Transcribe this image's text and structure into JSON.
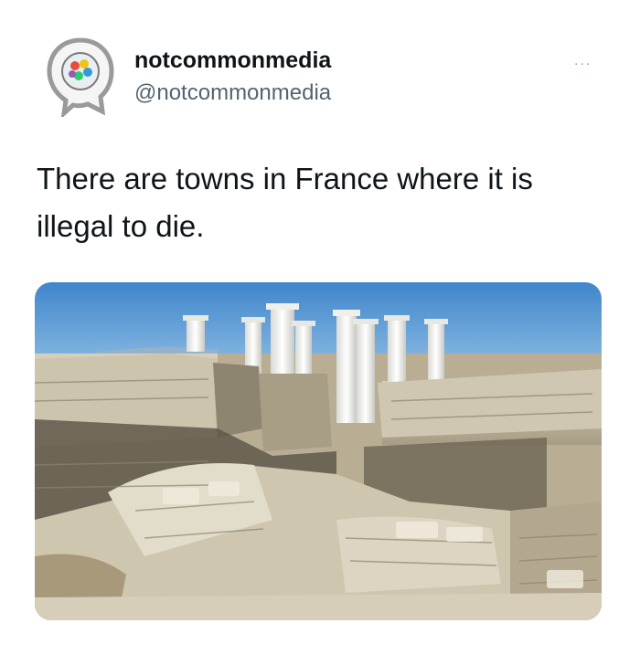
{
  "tweet": {
    "display_name": "notcommonmedia",
    "handle": "@notcommonmedia",
    "more_label": "...",
    "text": "There are towns in France where it is illegal to die."
  },
  "media": {
    "kind": "photo",
    "subject": "ancient-ruins-with-columns"
  },
  "colors": {
    "sky": "#4a90d0",
    "sea": "#1560b8",
    "stone": "#cfc7b3",
    "text": "#0f1419",
    "handle": "#536471"
  },
  "icons": {
    "avatar": "profile-avatar-icon",
    "more": "more-options-icon"
  }
}
